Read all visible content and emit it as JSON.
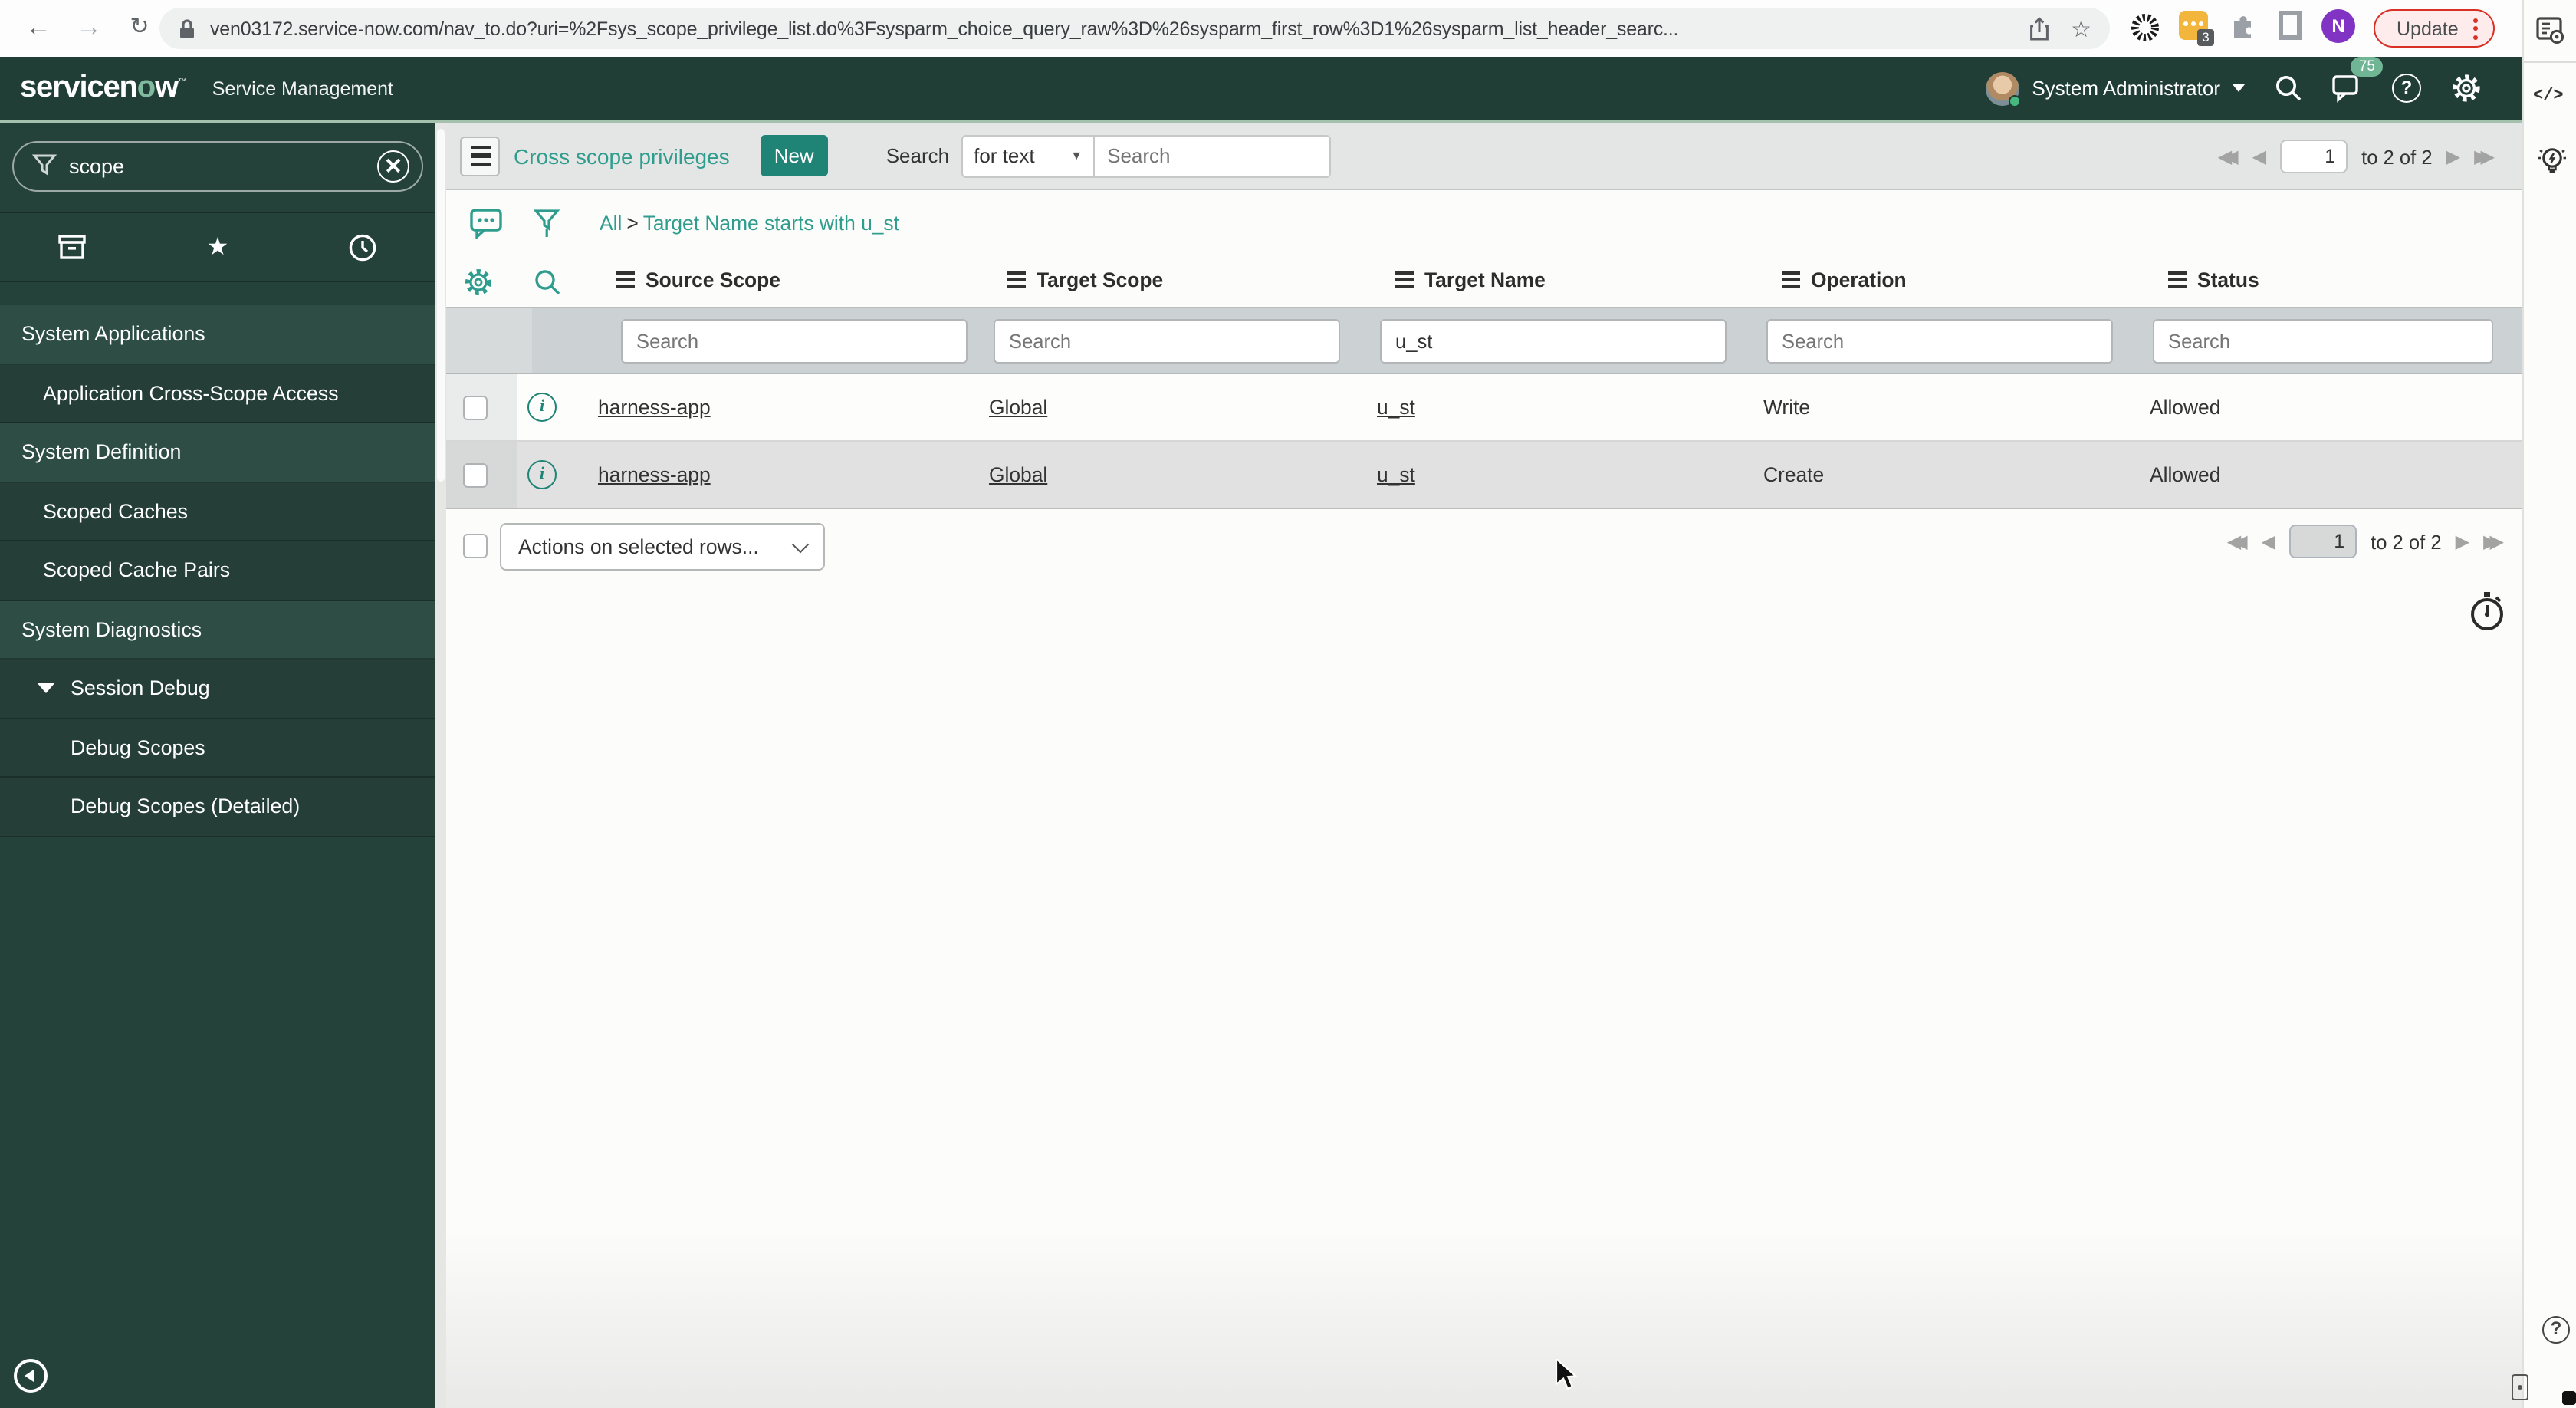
{
  "colors": {
    "banner": "#203d36",
    "sidebar": "#24423a",
    "accent_button": "#1f8476",
    "link": "#2f9d8e",
    "update_border": "#d93025",
    "filter_row": "#ccd1d3",
    "row_alt": "#e0e1e0",
    "badge": "#70b694"
  },
  "browser": {
    "url": "ven03172.service-now.com/nav_to.do?uri=%2Fsys_scope_privilege_list.do%3Fsysparm_choice_query_raw%3D%26sysparm_first_row%3D1%26sysparm_list_header_searc...",
    "update_label": "Update",
    "extension_badge": "3",
    "profile_initial": "N"
  },
  "icons": {
    "back": "←",
    "forward": "→",
    "reload": "↻",
    "bookmark_star": "☆",
    "favorites_star": "★",
    "select_caret": "▼",
    "code_panel": "</>",
    "pag_first": "◀◀",
    "pag_prev": "◀",
    "pag_next": "▶",
    "pag_last": "▶▶",
    "help": "?",
    "info": "i"
  },
  "banner": {
    "logo_pre": "servicen",
    "logo_o": "o",
    "logo_post": "w",
    "logo_tm": "™",
    "product": "Service Management",
    "user": "System Administrator",
    "notification_count": "75"
  },
  "sidebar": {
    "search_value": "scope",
    "items": [
      {
        "label": "System Applications",
        "type": "section"
      },
      {
        "label": "Application Cross-Scope Access",
        "type": "module"
      },
      {
        "label": "System Definition",
        "type": "section"
      },
      {
        "label": "Scoped Caches",
        "type": "module"
      },
      {
        "label": "Scoped Cache Pairs",
        "type": "module"
      },
      {
        "label": "System Diagnostics",
        "type": "section"
      },
      {
        "label": "Session Debug",
        "type": "module-expanded"
      },
      {
        "label": "Debug Scopes",
        "type": "submodule"
      },
      {
        "label": "Debug Scopes (Detailed)",
        "type": "submodule"
      }
    ]
  },
  "list": {
    "title": "Cross scope privileges",
    "new_label": "New",
    "search_label": "Search",
    "search_type": "for text",
    "search_placeholder": "Search",
    "breadcrumb": {
      "all": "All",
      "sep": ">",
      "query": "Target Name starts with u_st"
    },
    "columns": [
      "Source Scope",
      "Target Scope",
      "Target Name",
      "Operation",
      "Status"
    ],
    "filters": [
      {
        "placeholder": "Search",
        "value": ""
      },
      {
        "placeholder": "Search",
        "value": ""
      },
      {
        "placeholder": "Search",
        "value": "u_st"
      },
      {
        "placeholder": "Search",
        "value": ""
      },
      {
        "placeholder": "Search",
        "value": ""
      }
    ],
    "rows": [
      {
        "source_scope": "harness-app",
        "target_scope": "Global",
        "target_name": "u_st",
        "operation": "Write",
        "status": "Allowed"
      },
      {
        "source_scope": "harness-app",
        "target_scope": "Global",
        "target_name": "u_st",
        "operation": "Create",
        "status": "Allowed"
      }
    ],
    "actions_label": "Actions on selected rows...",
    "pagination": {
      "page": "1",
      "range_label": "to 2 of 2"
    }
  }
}
